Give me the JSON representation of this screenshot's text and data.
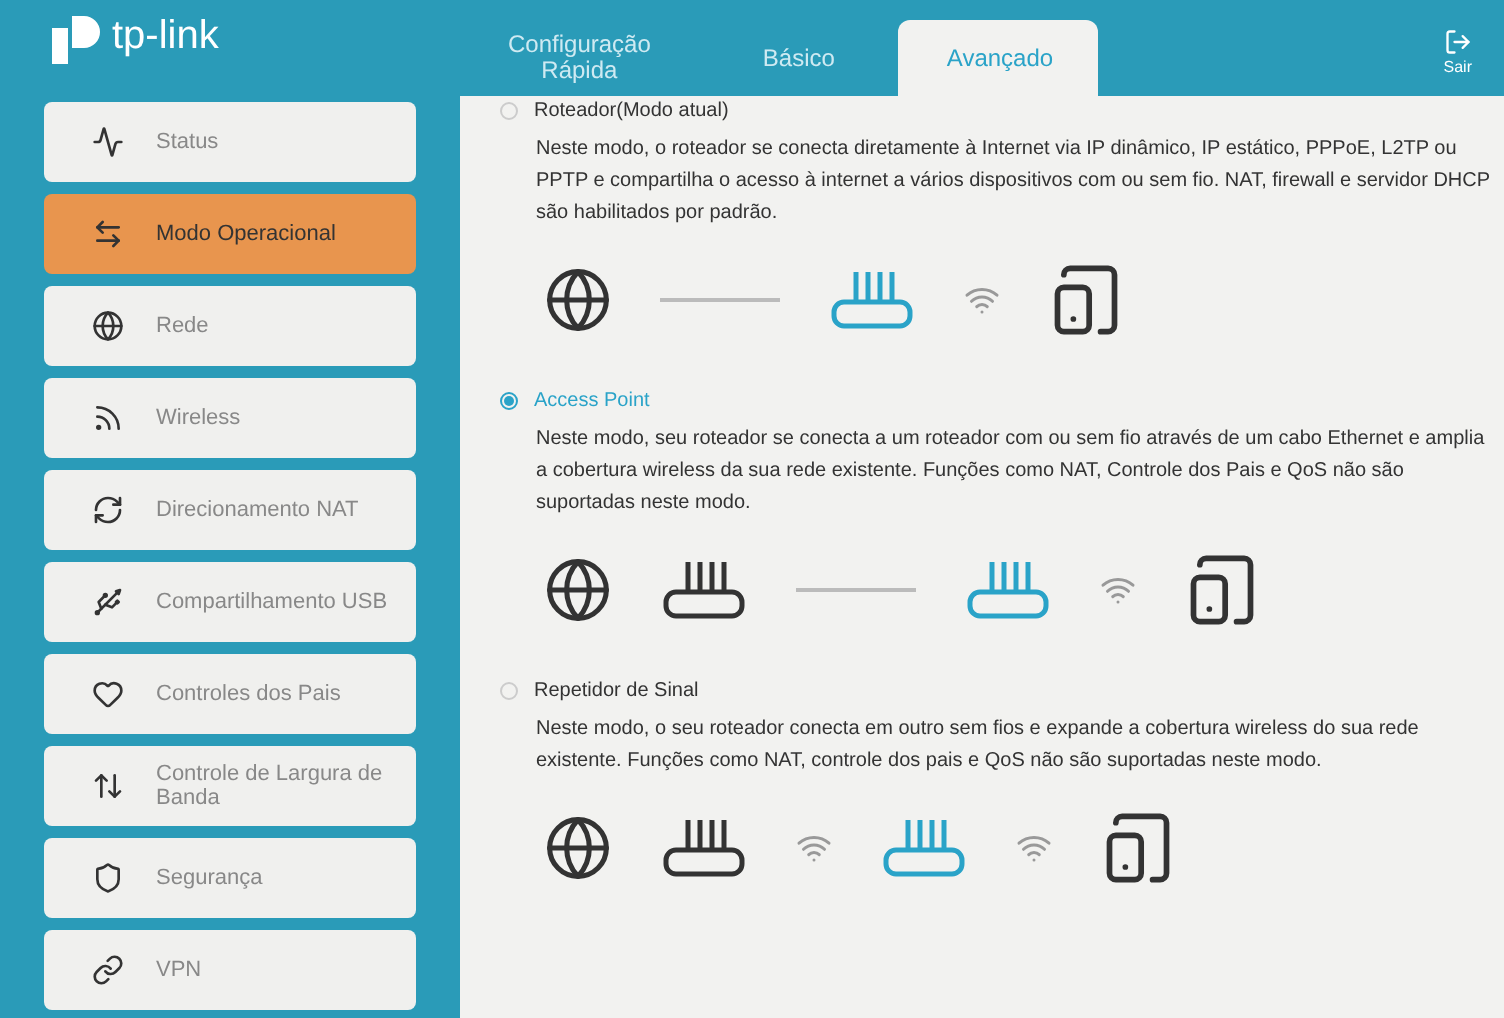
{
  "brand": {
    "name": "tp-link"
  },
  "tabs": [
    {
      "label": "Configuração\nRápida",
      "selected": false
    },
    {
      "label": "Básico",
      "selected": false
    },
    {
      "label": "Avançado",
      "selected": true
    }
  ],
  "exit": {
    "label": "Sair"
  },
  "sidebar": {
    "items": [
      {
        "kind": "status",
        "label": "Status",
        "selected": false
      },
      {
        "kind": "mode",
        "label": "Modo Operacional",
        "selected": true
      },
      {
        "kind": "network",
        "label": "Rede",
        "selected": false
      },
      {
        "kind": "wireless",
        "label": "Wireless",
        "selected": false
      },
      {
        "kind": "nat",
        "label": "Direcionamento NAT",
        "selected": false
      },
      {
        "kind": "usb",
        "label": "Compartilhamento USB",
        "selected": false
      },
      {
        "kind": "parental",
        "label": "Controles dos Pais",
        "selected": false
      },
      {
        "kind": "bandwidth",
        "label": "Controle de Largura de Banda",
        "selected": false
      },
      {
        "kind": "security",
        "label": "Segurança",
        "selected": false
      },
      {
        "kind": "vpn",
        "label": "VPN",
        "selected": false
      }
    ]
  },
  "modes": [
    {
      "label": "Roteador(Modo atual)",
      "selected": false,
      "description": "Neste modo, o roteador se conecta diretamente à Internet via IP dinâmico, IP estático, PPPoE, L2TP ou PPTP e compartilha o acesso à internet a vários dispositivos com ou sem fio. NAT, firewall e servidor DHCP são habilitados por padrão.",
      "diagram": [
        {
          "kind": "globe"
        },
        {
          "kind": "line"
        },
        {
          "kind": "router",
          "highlighted": true
        },
        {
          "kind": "wifi"
        },
        {
          "kind": "tablet"
        }
      ]
    },
    {
      "label": "Access Point",
      "selected": true,
      "description": "Neste modo, seu roteador se conecta a um roteador com ou sem fio através de um cabo Ethernet e amplia a cobertura wireless da sua rede existente. Funções como NAT, Controle dos Pais e QoS não são suportadas neste modo.",
      "diagram": [
        {
          "kind": "globe"
        },
        {
          "kind": "router",
          "highlighted": false
        },
        {
          "kind": "line"
        },
        {
          "kind": "router",
          "highlighted": true
        },
        {
          "kind": "wifi"
        },
        {
          "kind": "tablet"
        }
      ]
    },
    {
      "label": "Repetidor de Sinal",
      "selected": false,
      "description": "Neste modo, o seu roteador conecta em outro sem fios e expande a cobertura wireless do sua rede existente. Funções como NAT, controle dos pais e QoS não são suportadas neste modo.",
      "diagram": [
        {
          "kind": "globe"
        },
        {
          "kind": "router",
          "highlighted": false
        },
        {
          "kind": "wifi"
        },
        {
          "kind": "router",
          "highlighted": true
        },
        {
          "kind": "wifi"
        },
        {
          "kind": "tablet"
        }
      ]
    }
  ]
}
